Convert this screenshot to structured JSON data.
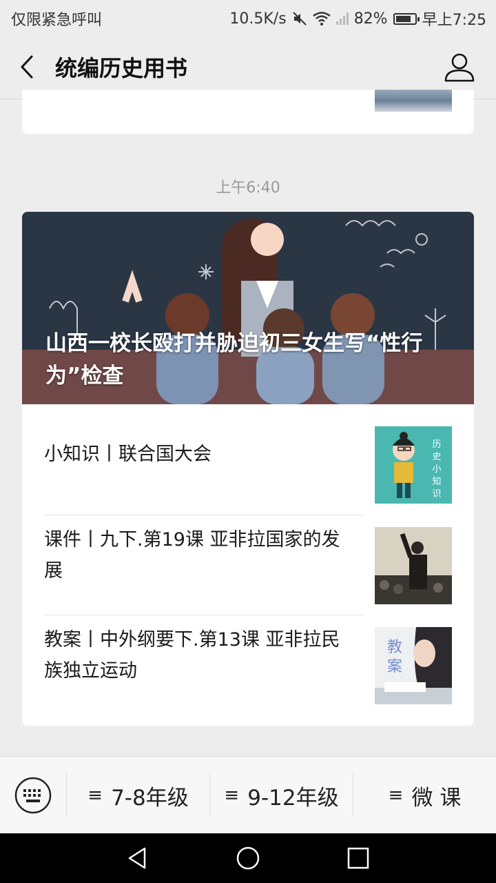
{
  "status_bar": {
    "carrier_text": "仅限紧急呼叫",
    "network_speed": "10.5K/s",
    "battery_percent": "82%",
    "battery_level": 0.82,
    "time": "早上7:25",
    "icons": [
      "mute-icon",
      "wifi-icon",
      "signal-icon",
      "battery-icon"
    ]
  },
  "nav": {
    "title": "统编历史用书",
    "back_icon": "back-chevron-icon",
    "profile_icon": "person-icon"
  },
  "message": {
    "timestamp": "上午6:40",
    "headline": "山西一校长殴打并胁迫初三女生写“性行为”检查",
    "items": [
      {
        "title": "小知识丨联合国大会",
        "thumb_text": "历史小知识"
      },
      {
        "title": "课件丨九下.第19课 亚非拉国家的发展"
      },
      {
        "title": "教案丨中外纲要下.第13课 亚非拉民族独立运动",
        "thumb_text": "教案"
      }
    ]
  },
  "bottom_menu": {
    "keyboard_icon": "keyboard-icon",
    "menu_icon": "≡",
    "items": [
      "7-8年级",
      "9-12年级",
      "微 课"
    ]
  },
  "system_nav": [
    "back-triangle-icon",
    "home-circle-icon",
    "recents-square-icon"
  ],
  "colors": {
    "background": "#ededed",
    "card": "#ffffff",
    "timestamp": "#9a9a9a",
    "system_nav": "#000000"
  }
}
